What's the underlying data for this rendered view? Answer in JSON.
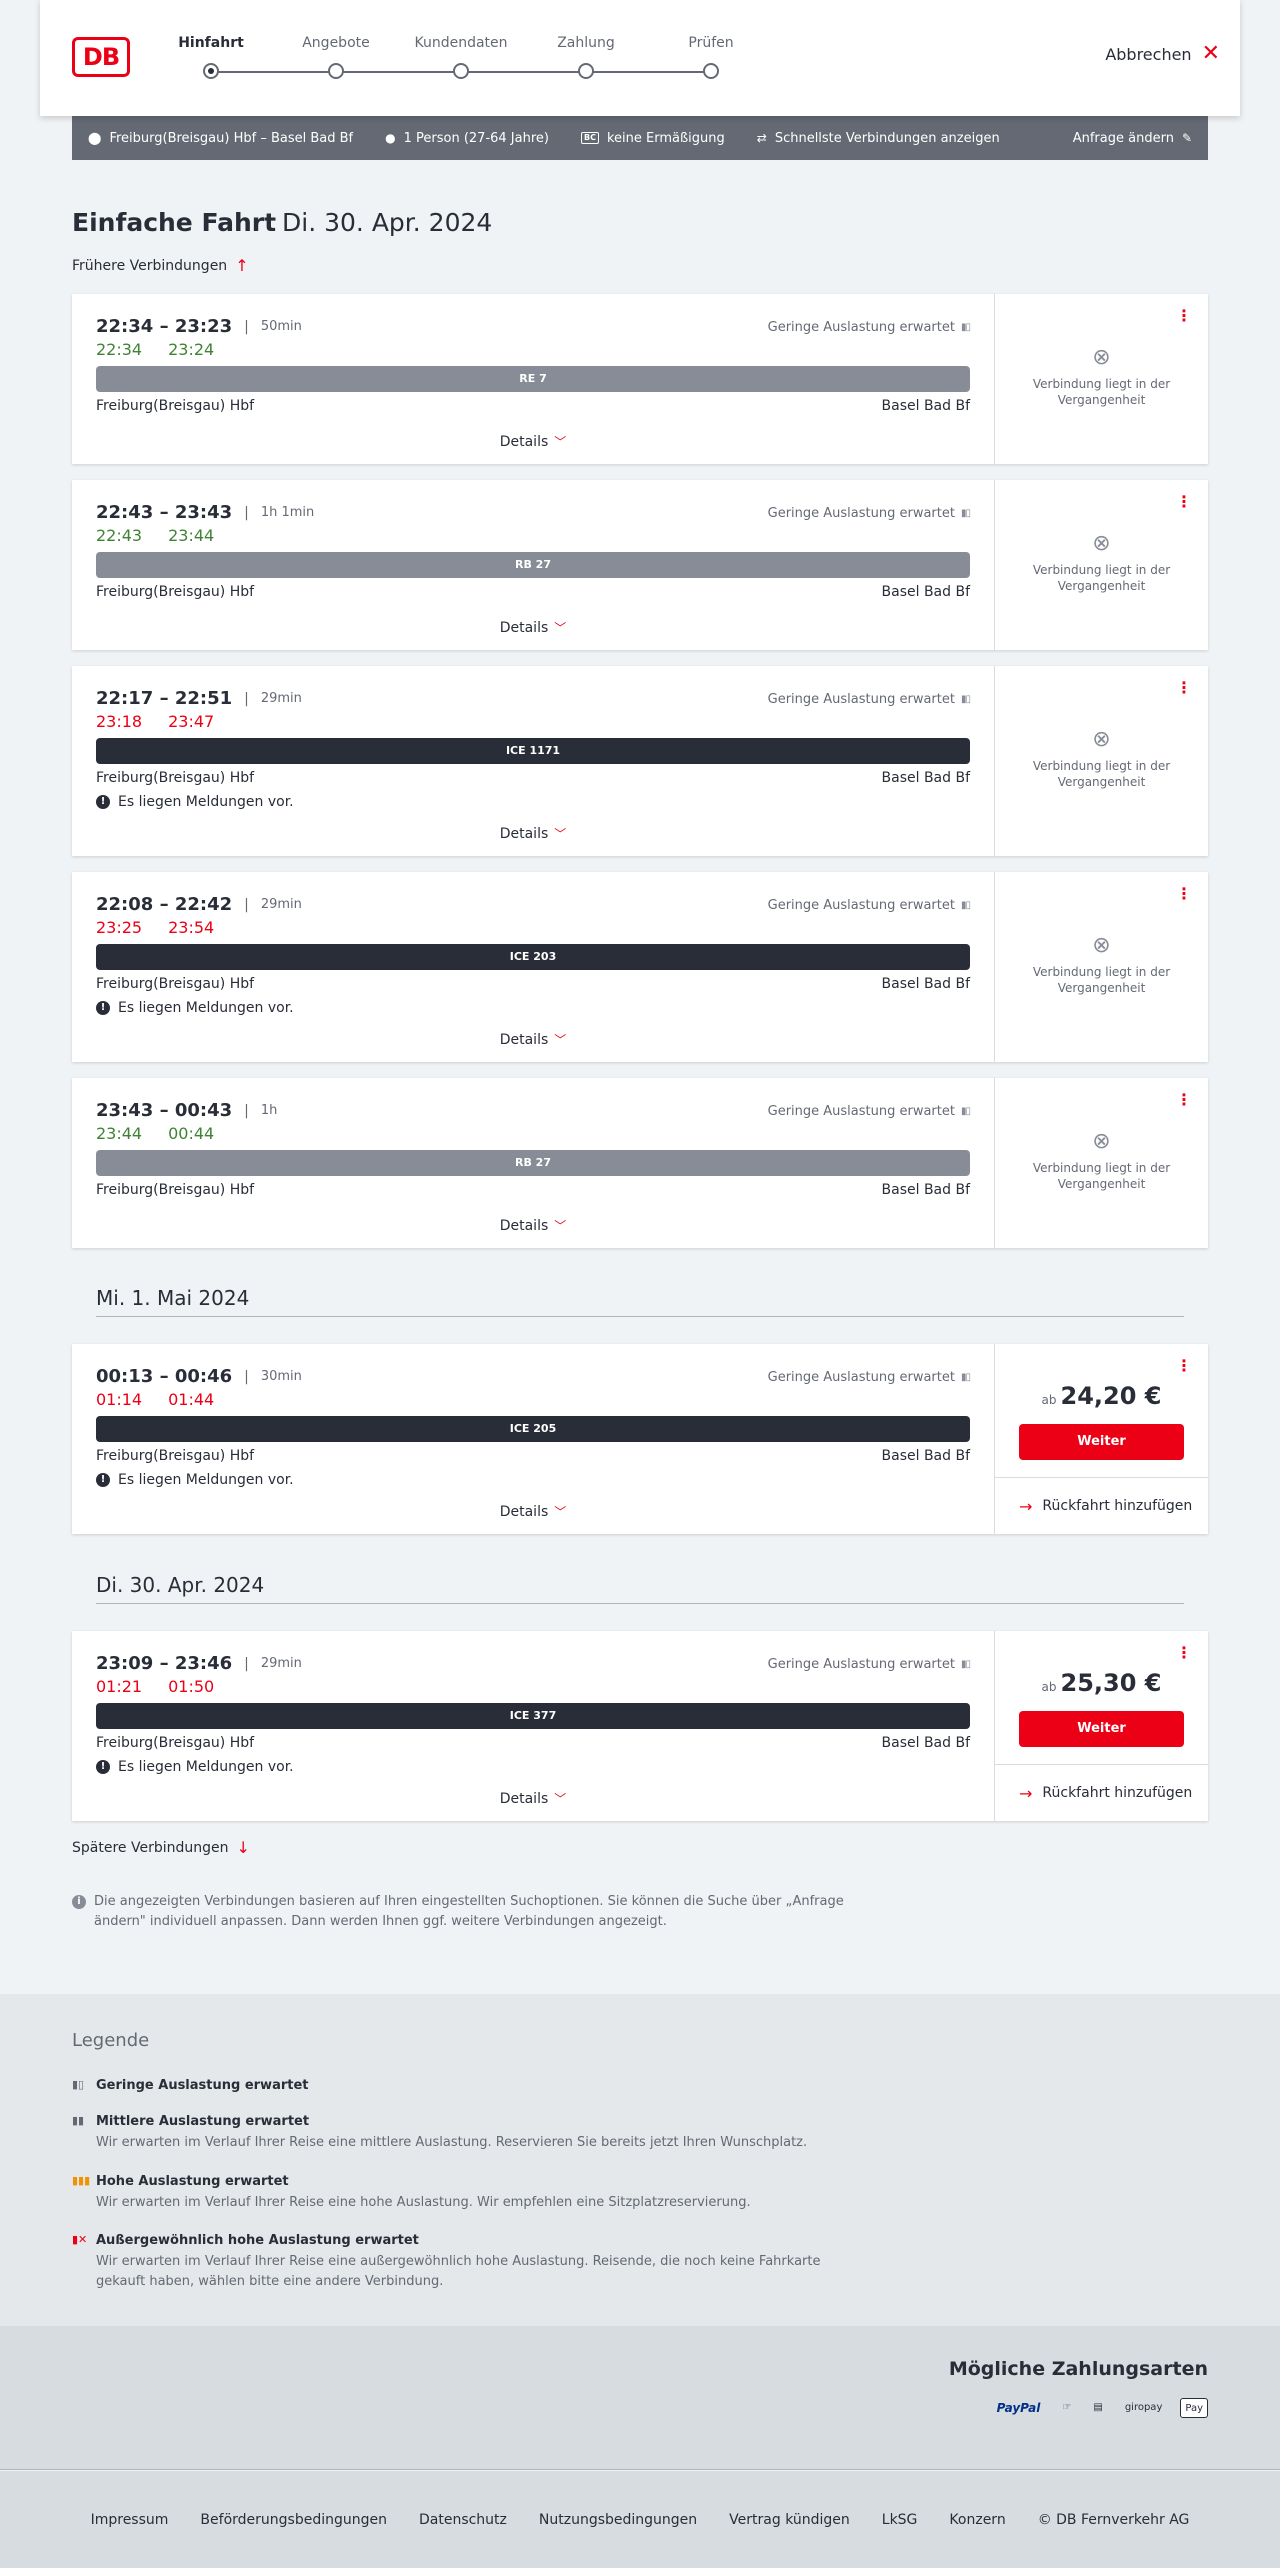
{
  "header": {
    "logo": "DB",
    "steps": [
      {
        "label": "Hinfahrt",
        "active": true
      },
      {
        "label": "Angebote",
        "active": false
      },
      {
        "label": "Kundendaten",
        "active": false
      },
      {
        "label": "Zahlung",
        "active": false
      },
      {
        "label": "Prüfen",
        "active": false
      }
    ],
    "cancel_label": "Abbrechen"
  },
  "search": {
    "route": "Freiburg(Breisgau) Hbf – Basel Bad Bf",
    "passengers": "1 Person (27-64 Jahre)",
    "discount_badge": "BC",
    "discount": "keine Ermäßigung",
    "fastest": "Schnellste Verbindungen anzeigen",
    "edit": "Anfrage ändern"
  },
  "page": {
    "title_bold": "Einfache Fahrt",
    "title_date": "Di. 30. Apr. 2024",
    "earlier": "Frühere Verbindungen",
    "later": "Spätere Verbindungen"
  },
  "labels": {
    "details": "Details",
    "messages": "Es liegen Meldungen vor.",
    "past": "Verbindung liegt in der Vergangenheit",
    "price_prefix": "ab",
    "continue": "Weiter",
    "return": "Rückfahrt hinzufügen"
  },
  "day_headers": [
    "Mi. 1. Mai 2024",
    "Di. 30. Apr. 2024"
  ],
  "connections": [
    {
      "plan": "22:34 – 23:23",
      "duration": "50min",
      "rt_dep": "22:34",
      "rt_arr": "23:24",
      "rt_status": "on",
      "load": "Geringe Auslastung erwartet",
      "train": "RE 7",
      "train_type": "regio",
      "from": "Freiburg(Breisgau) Hbf",
      "to": "Basel Bad Bf",
      "messages": false,
      "price": null
    },
    {
      "plan": "22:43 – 23:43",
      "duration": "1h 1min",
      "rt_dep": "22:43",
      "rt_arr": "23:44",
      "rt_status": "on",
      "load": "Geringe Auslastung erwartet",
      "train": "RB 27",
      "train_type": "regio",
      "from": "Freiburg(Breisgau) Hbf",
      "to": "Basel Bad Bf",
      "messages": false,
      "price": null
    },
    {
      "plan": "22:17 – 22:51",
      "duration": "29min",
      "rt_dep": "23:18",
      "rt_arr": "23:47",
      "rt_status": "late",
      "load": "Geringe Auslastung erwartet",
      "train": "ICE 1171",
      "train_type": "ice",
      "from": "Freiburg(Breisgau) Hbf",
      "to": "Basel Bad Bf",
      "messages": true,
      "price": null
    },
    {
      "plan": "22:08 – 22:42",
      "duration": "29min",
      "rt_dep": "23:25",
      "rt_arr": "23:54",
      "rt_status": "late",
      "load": "Geringe Auslastung erwartet",
      "train": "ICE 203",
      "train_type": "ice",
      "from": "Freiburg(Breisgau) Hbf",
      "to": "Basel Bad Bf",
      "messages": true,
      "price": null
    },
    {
      "plan": "23:43 – 00:43",
      "duration": "1h",
      "rt_dep": "23:44",
      "rt_arr": "00:44",
      "rt_status": "on",
      "load": "Geringe Auslastung erwartet",
      "train": "RB 27",
      "train_type": "regio",
      "from": "Freiburg(Breisgau) Hbf",
      "to": "Basel Bad Bf",
      "messages": false,
      "price": null
    },
    {
      "plan": "00:13 – 00:46",
      "duration": "30min",
      "rt_dep": "01:14",
      "rt_arr": "01:44",
      "rt_status": "late",
      "load": "Geringe Auslastung erwartet",
      "train": "ICE 205",
      "train_type": "ice",
      "from": "Freiburg(Breisgau) Hbf",
      "to": "Basel Bad Bf",
      "messages": true,
      "price": "24,20 €"
    },
    {
      "plan": "23:09 – 23:46",
      "duration": "29min",
      "rt_dep": "01:21",
      "rt_arr": "01:50",
      "rt_status": "late",
      "load": "Geringe Auslastung erwartet",
      "train": "ICE 377",
      "train_type": "ice",
      "from": "Freiburg(Breisgau) Hbf",
      "to": "Basel Bad Bf",
      "messages": true,
      "price": "25,30 €"
    }
  ],
  "info_note": "Die angezeigten Verbindungen basieren auf Ihren eingestellten Suchoptionen. Sie können die Suche über „Anfrage ändern\" individuell anpassen. Dann werden Ihnen ggf. weitere Verbindungen angezeigt.",
  "legend": {
    "title": "Legende",
    "items": [
      {
        "heading": "Geringe Auslastung erwartet",
        "text": "",
        "icon": "low-occupancy-icon",
        "color": "#646973"
      },
      {
        "heading": "Mittlere Auslastung erwartet",
        "text": "Wir erwarten im Verlauf Ihrer Reise eine mittlere Auslastung. Reservieren Sie bereits jetzt Ihren Wunschplatz.",
        "icon": "medium-occupancy-icon",
        "color": "#646973"
      },
      {
        "heading": "Hohe Auslastung erwartet",
        "text": "Wir erwarten im Verlauf Ihrer Reise eine hohe Auslastung. Wir empfehlen eine Sitzplatzreservierung.",
        "icon": "high-occupancy-icon",
        "color": "#f39200"
      },
      {
        "heading": "Außergewöhnlich hohe Auslastung erwartet",
        "text": "Wir erwarten im Verlauf Ihrer Reise eine außergewöhnlich hohe Auslastung. Reisende, die noch keine Fahrkarte gekauft haben, wählen bitte eine andere Verbindung.",
        "icon": "very-high-occupancy-icon",
        "color": "#ec0016"
      }
    ]
  },
  "payment": {
    "title": "Mögliche Zahlungsarten",
    "methods": [
      "PayPal",
      "Kreditkarte",
      "SEPA Lastschrift",
      "giropay",
      "Apple Pay"
    ],
    "visible": {
      "paypal": "PayPal",
      "giropay": "giropay",
      "apple": "Pay"
    }
  },
  "footer": [
    "Impressum",
    "Beförderungsbedingungen",
    "Datenschutz",
    "Nutzungsbedingungen",
    "Vertrag kündigen",
    "LkSG",
    "Konzern",
    "© DB Fernverkehr AG"
  ],
  "colors": {
    "brand": "#ec0016",
    "on_time": "#408335",
    "late": "#ec0016",
    "ice_bar": "#282d37",
    "regio_bar": "#878c96"
  }
}
